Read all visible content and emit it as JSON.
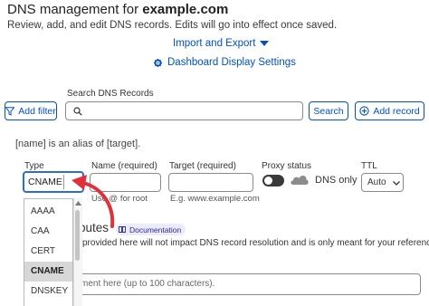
{
  "header": {
    "title_prefix": "DNS management for ",
    "title_domain": "example.com",
    "description": "Review, add, and edit DNS records. Edits will go into effect once saved."
  },
  "links": {
    "import_export": "Import and Export",
    "dashboard_settings": "Dashboard Display Settings"
  },
  "toolbar": {
    "add_filter": "Add filter",
    "search_label": "Search DNS Records",
    "search_placeholder": "",
    "search_button": "Search",
    "add_record": "Add record"
  },
  "alias_note": "[name] is an alias of [target].",
  "form": {
    "type_label": "Type",
    "type_value": "CNAME",
    "name_label": "Name (required)",
    "name_hint": "Use @ for root",
    "target_label": "Target (required)",
    "target_hint": "E.g. www.example.com",
    "proxy_label": "Proxy status",
    "proxy_value": "DNS only",
    "ttl_label": "TTL",
    "ttl_value": "Auto"
  },
  "type_options": [
    "AAAA",
    "CAA",
    "CERT",
    "CNAME",
    "DNSKEY"
  ],
  "selected_type_index": 3,
  "record_attributes": {
    "heading_visible": "butes",
    "documentation": "Documentation",
    "info_visible": "provided here will not impact DNS record resolution and is only meant for your reference.",
    "comment_placeholder_visible": "ment here (up to 100 characters)."
  },
  "colors": {
    "link_blue": "#0051c3",
    "annotation_red": "#e0313a",
    "toggle_dark": "#3a3a3a"
  }
}
